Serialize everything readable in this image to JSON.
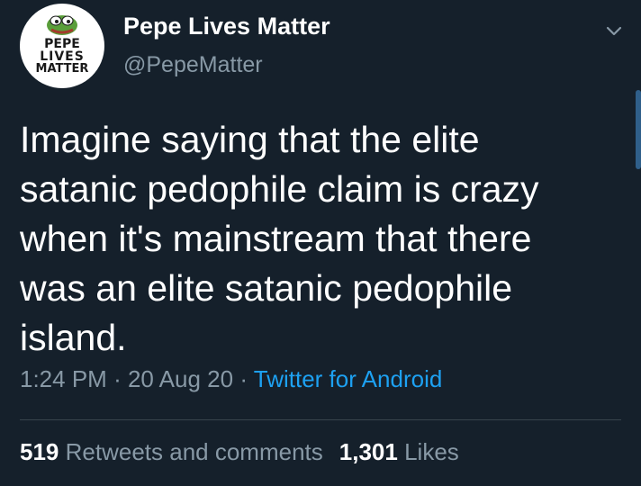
{
  "profile": {
    "display_name": "Pepe Lives Matter",
    "handle": "@PepeMatter",
    "avatar_logo_text": [
      "PEPE",
      "LIVES",
      "MATTER"
    ]
  },
  "tweet": {
    "text": "Imagine saying that the elite satanic pedophile claim is crazy when it's mainstream that there was an elite satanic pedophile island.",
    "time": "1:24 PM",
    "separator": "·",
    "date": "20 Aug 20",
    "source": "Twitter for Android"
  },
  "stats": {
    "retweets_count": "519",
    "retweets_label": "Retweets and comments",
    "likes_count": "1,301",
    "likes_label": "Likes"
  },
  "icons": {
    "menu": "chevron-down-icon"
  },
  "colors": {
    "background": "#15202b",
    "primary_text": "#ffffff",
    "secondary_text": "#8899a6",
    "link": "#1da1f2",
    "divider": "#38444d"
  }
}
